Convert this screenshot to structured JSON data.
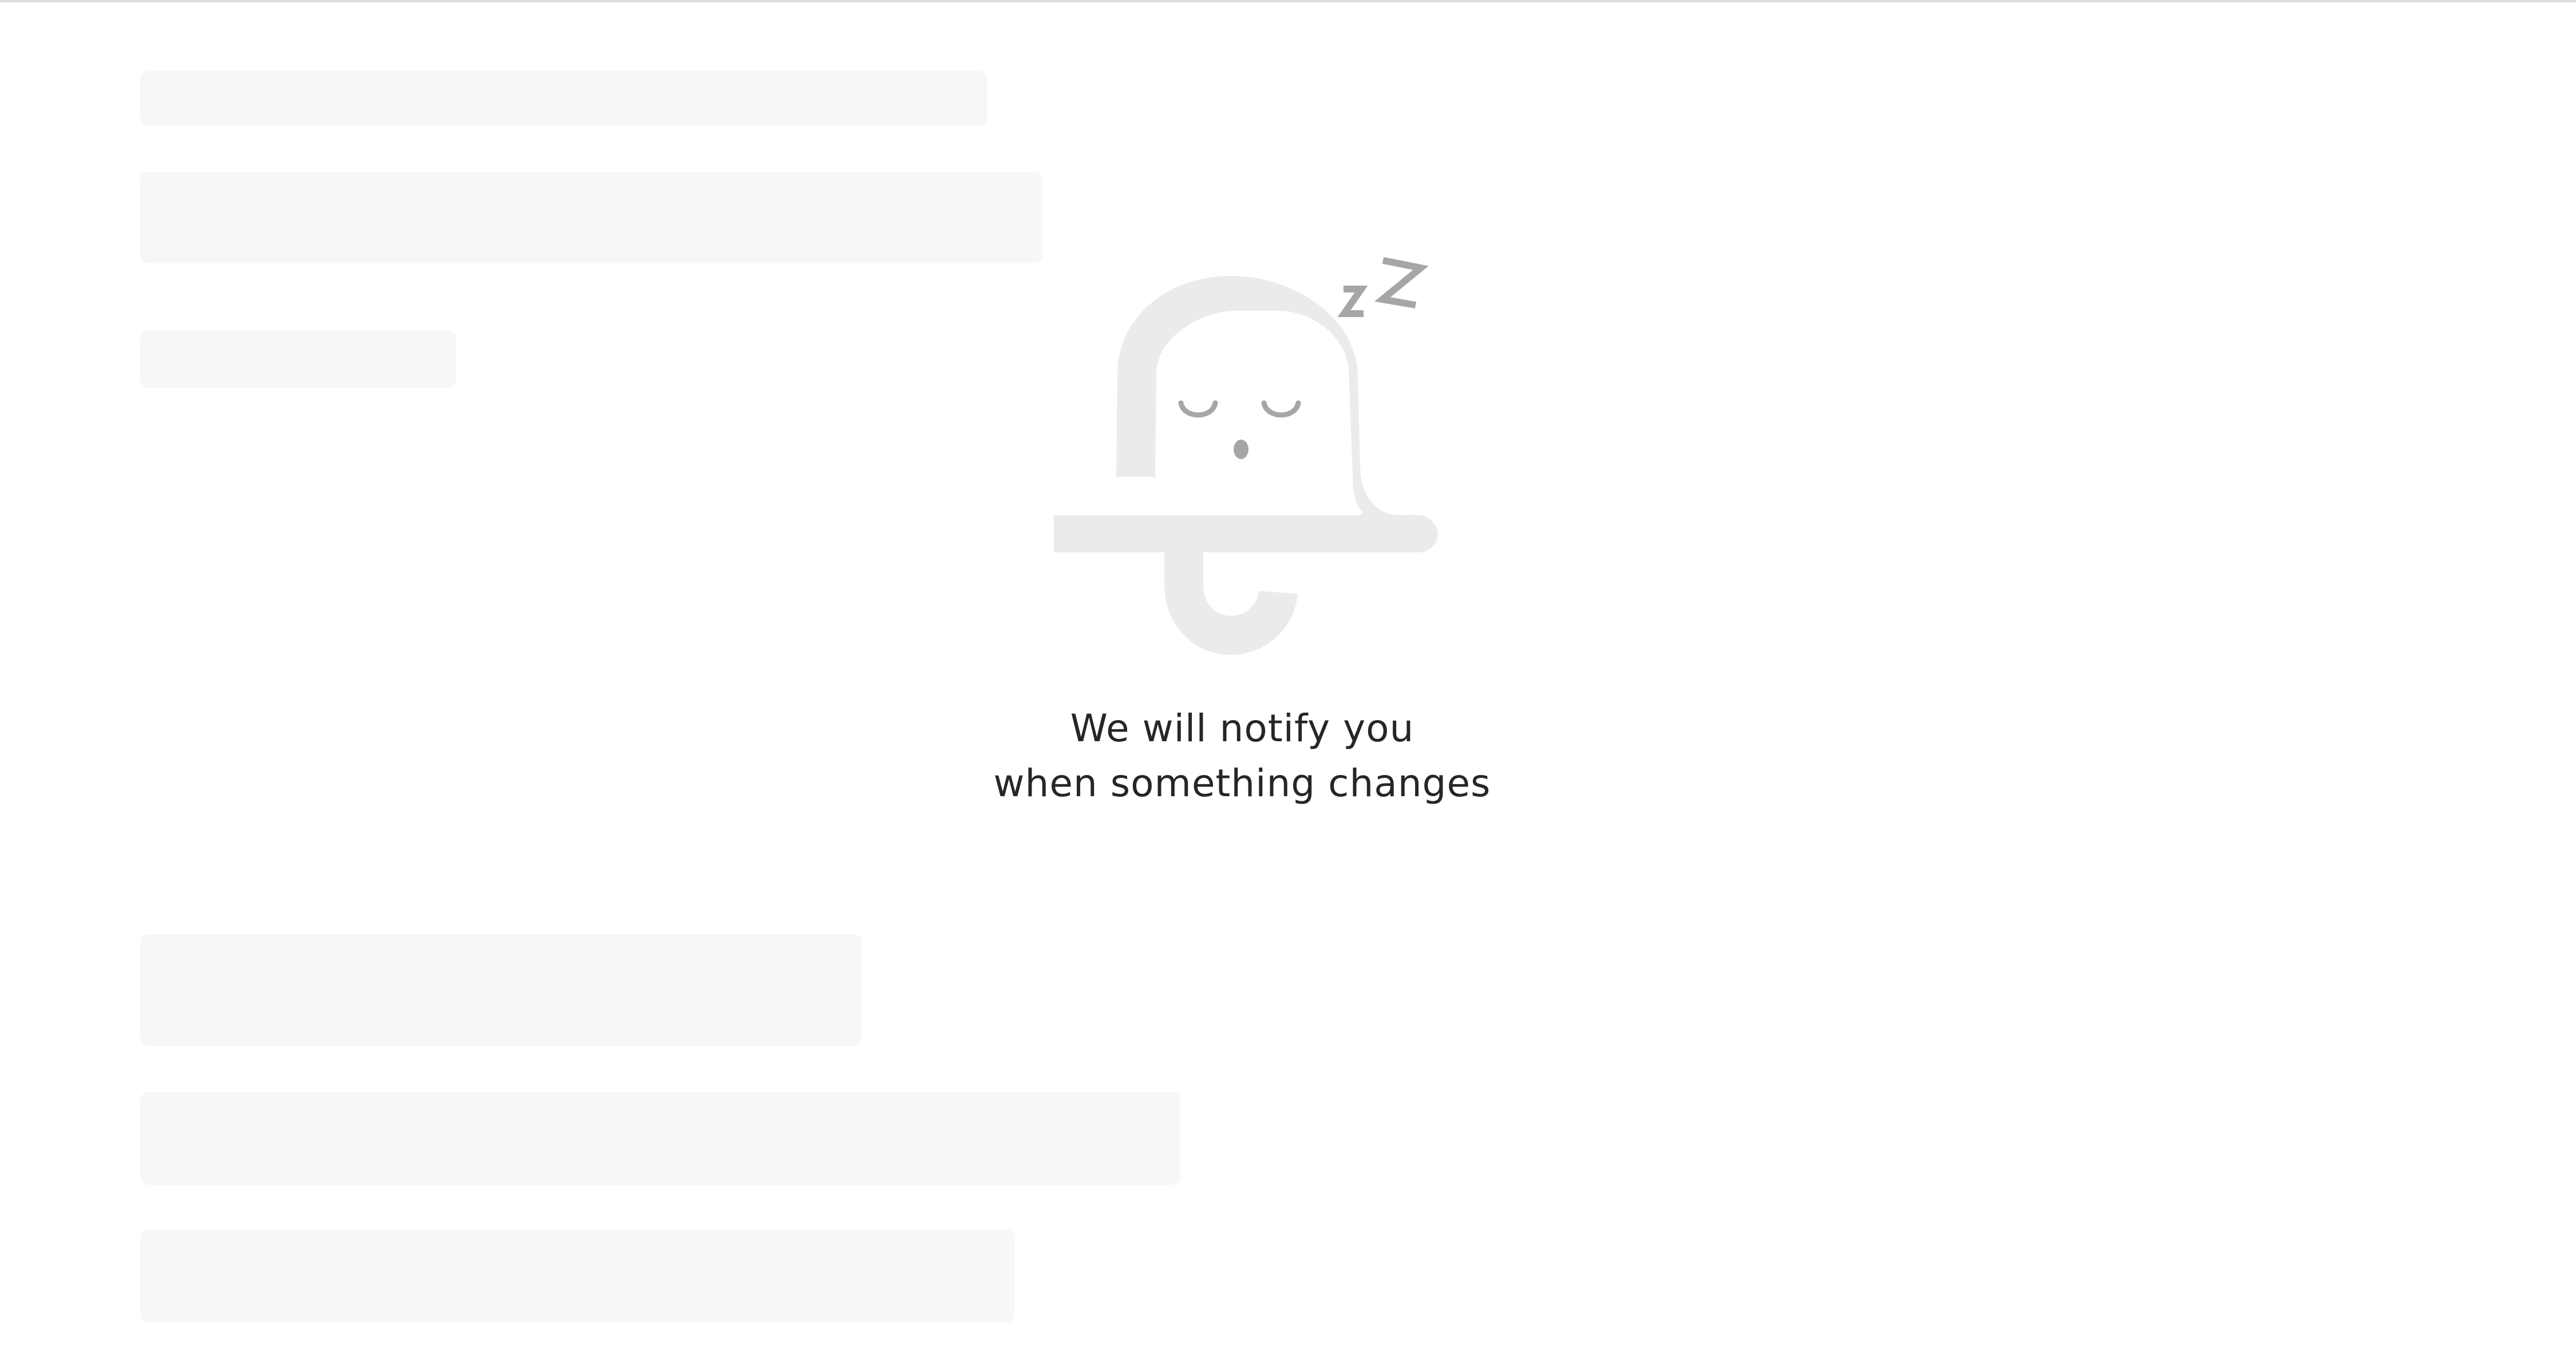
{
  "empty_state": {
    "line1": "We will notify you",
    "line2": "when something changes",
    "illustration_icon": "sleeping-bell-icon",
    "snore_icon": "zz-icon"
  },
  "colors": {
    "background": "#ffffff",
    "skeleton": "#f7f7f7",
    "bell_body": "#ebebeb",
    "bell_features": "#a6a6a6",
    "text": "#262626",
    "top_border": "#dedede"
  }
}
